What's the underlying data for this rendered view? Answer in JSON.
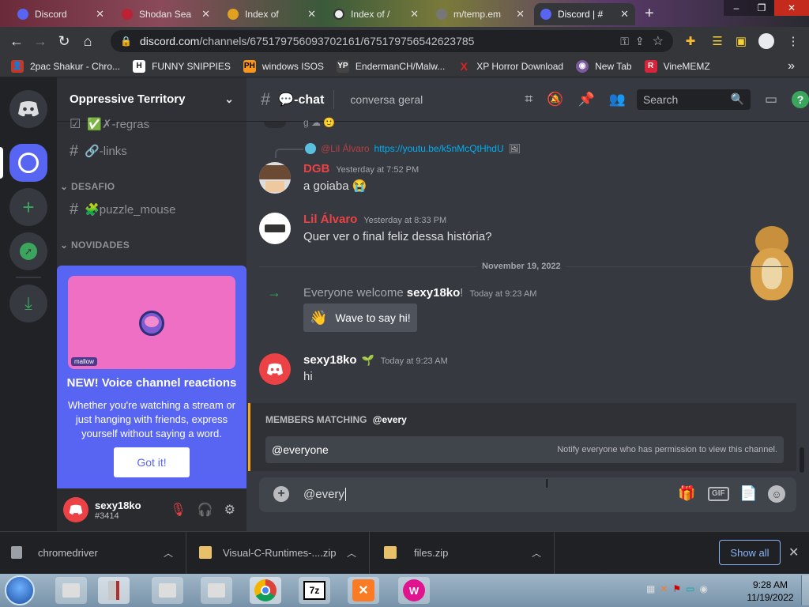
{
  "browser": {
    "tabs": [
      {
        "title": "Discord"
      },
      {
        "title": "Shodan Sea"
      },
      {
        "title": "Index of"
      },
      {
        "title": "Index of /"
      },
      {
        "title": "m/temp.em"
      },
      {
        "title": "Discord | #"
      }
    ],
    "new_tab": "+",
    "url_host": "discord.com",
    "url_path": "/channels/675179756093702161/675179756542623785",
    "bookmarks": [
      {
        "label": "2pac Shakur - Chro...",
        "icon": "user-icon",
        "color": "#c0392b"
      },
      {
        "label": "FUNNY SNIPPIES",
        "icon": "H",
        "color": "#222222"
      },
      {
        "label": "windows ISOS",
        "icon": "PH",
        "color": "#f7971d"
      },
      {
        "label": "EndermanCH/Malw...",
        "icon": "YP",
        "color": "#333333"
      },
      {
        "label": "XP Horror Download",
        "icon": "X",
        "color": "#e02020"
      },
      {
        "label": "New Tab",
        "icon": "globe-icon",
        "color": "#7b5a9e"
      },
      {
        "label": "VineMEMZ",
        "icon": "R",
        "color": "#d6243b"
      }
    ],
    "more_bookmarks": "»"
  },
  "sidebar": {
    "server_name": "Oppressive Territory",
    "channels_top": [
      {
        "label": "✅✗-regras",
        "hash": "☑"
      },
      {
        "label": "🔗-links",
        "hash": "#"
      }
    ],
    "category_desafio": "DESAFIO",
    "channel_puzzle": "🧩puzzle_mouse",
    "category_novidades": "NOVIDADES",
    "promo_badge": "mallow",
    "promo_title": "NEW! Voice channel reactions",
    "promo_body": "Whether you're watching a stream or just hanging with friends, express yourself without saying a word.",
    "promo_button": "Got it!",
    "user_name": "sexy18ko",
    "user_tag": "#3414"
  },
  "chat": {
    "channel_name": "💬-chat",
    "topic": "conversa geral",
    "search_placeholder": "Search",
    "reply_user": "@Lil Álvaro",
    "reply_link": "https://youtu.be/k5nMcQtHhdU",
    "messages": [
      {
        "user": "DGB",
        "time": "Yesterday at 7:52 PM",
        "text": "a goiaba 😭",
        "color": "#ed4245"
      },
      {
        "user": "Lil Álvaro",
        "time": "Yesterday at 8:33 PM",
        "text": "Quer ver o final feliz dessa história?",
        "color": "#ed4245"
      }
    ],
    "date_divider": "November 19, 2022",
    "welcome_prefix": "Everyone welcome ",
    "welcome_user": "sexy18ko",
    "welcome_suffix": "!",
    "welcome_time": "Today at 9:23 AM",
    "wave_button": "Wave to say hi!",
    "last_msg": {
      "user": "sexy18ko",
      "time": "Today at 9:23 AM",
      "text": "hi"
    },
    "autocomplete_header": "MEMBERS MATCHING",
    "autocomplete_query": "@every",
    "autocomplete_item": "@everyone",
    "autocomplete_desc": "Notify everyone who has permission to view this channel.",
    "composer_value": "@every",
    "gif_label": "GIF"
  },
  "downloads": {
    "items": [
      {
        "label": "chromedriver"
      },
      {
        "label": "Visual-C-Runtimes-....zip"
      },
      {
        "label": "files.zip"
      }
    ],
    "show_all": "Show all"
  },
  "taskbar": {
    "time": "9:28 AM",
    "date": "11/19/2022"
  }
}
